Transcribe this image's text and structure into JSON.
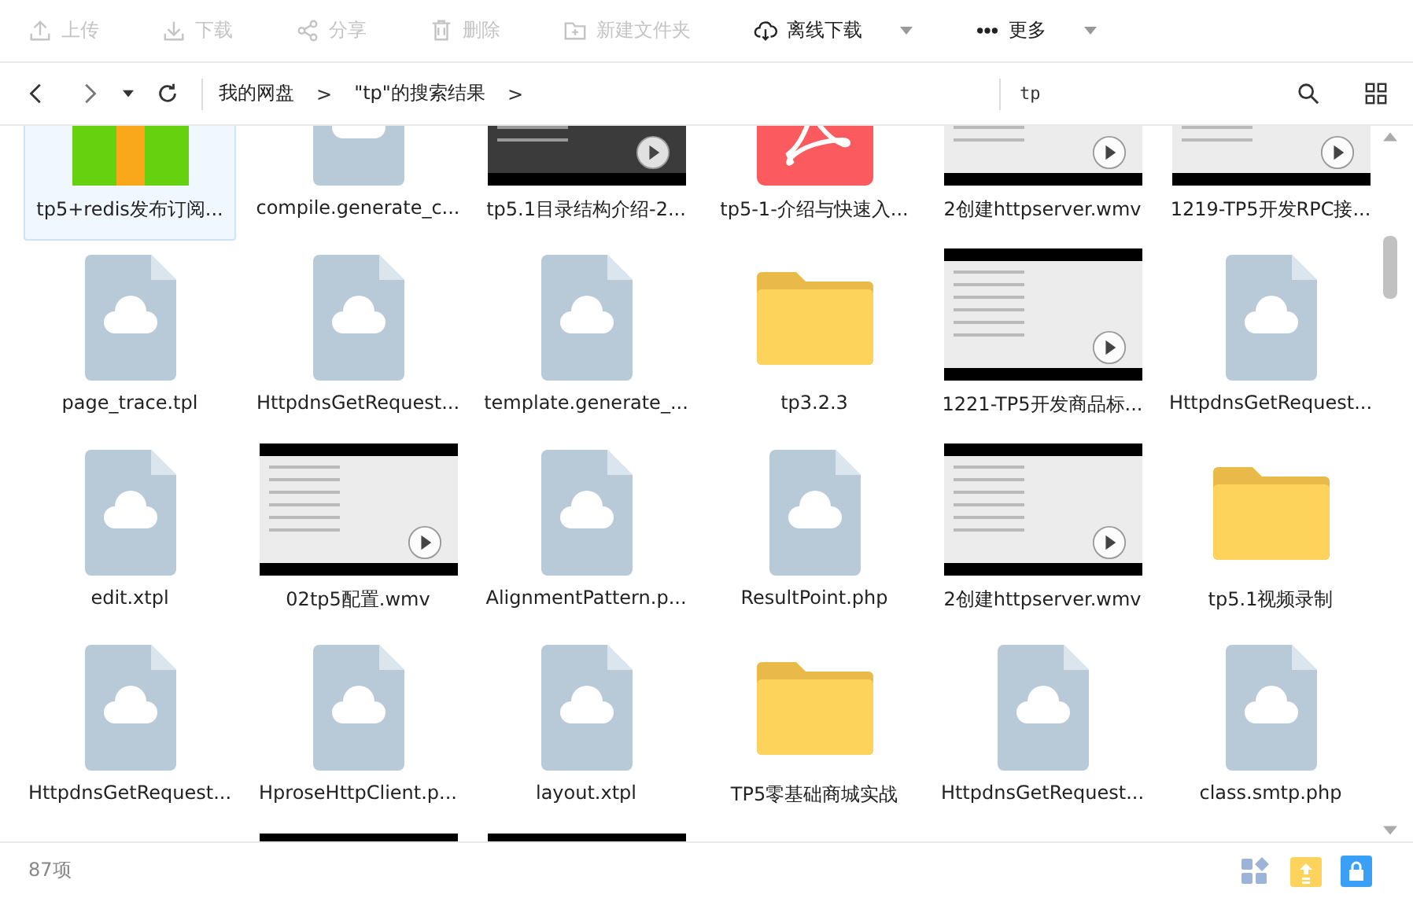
{
  "toolbar": [
    {
      "label": "上传",
      "disabled": true,
      "dropdown": false
    },
    {
      "label": "下载",
      "disabled": true,
      "dropdown": false
    },
    {
      "label": "分享",
      "disabled": true,
      "dropdown": false
    },
    {
      "label": "删除",
      "disabled": true,
      "dropdown": false
    },
    {
      "label": "新建文件夹",
      "disabled": true,
      "dropdown": false
    },
    {
      "label": "离线下载",
      "disabled": false,
      "dropdown": true
    },
    {
      "label": "更多",
      "disabled": false,
      "dropdown": true
    }
  ],
  "breadcrumb": [
    {
      "label": "我的网盘",
      "separator": ">"
    },
    {
      "label": "\"tp\"的搜索结果",
      "separator": ">"
    }
  ],
  "search": {
    "value": "tp"
  },
  "items": [
    {
      "kind": "archive",
      "label": "tp5+redis发布订阅...",
      "selected": true
    },
    {
      "kind": "file",
      "label": "compile.generate_c...",
      "selected": false
    },
    {
      "kind": "video-dark",
      "label": "tp5.1目录结构介绍-2...",
      "selected": false
    },
    {
      "kind": "pdf",
      "label": "tp5-1-介绍与快速入...",
      "selected": false
    },
    {
      "kind": "video",
      "label": "2创建httpserver.wmv",
      "selected": false
    },
    {
      "kind": "video",
      "label": "1219-TP5开发RPC接...",
      "selected": false
    },
    {
      "kind": "file",
      "label": "page_trace.tpl",
      "selected": false
    },
    {
      "kind": "file",
      "label": "HttpdnsGetRequest...",
      "selected": false
    },
    {
      "kind": "file",
      "label": "template.generate_...",
      "selected": false
    },
    {
      "kind": "folder",
      "label": "tp3.2.3",
      "selected": false
    },
    {
      "kind": "video",
      "label": "1221-TP5开发商品标...",
      "selected": false
    },
    {
      "kind": "file",
      "label": "HttpdnsGetRequest...",
      "selected": false
    },
    {
      "kind": "file",
      "label": "edit.xtpl",
      "selected": false
    },
    {
      "kind": "video",
      "label": "02tp5配置.wmv",
      "selected": false
    },
    {
      "kind": "file",
      "label": "AlignmentPattern.p...",
      "selected": false
    },
    {
      "kind": "file",
      "label": "ResultPoint.php",
      "selected": false
    },
    {
      "kind": "video",
      "label": "2创建httpserver.wmv",
      "selected": false
    },
    {
      "kind": "folder",
      "label": "tp5.1视频录制",
      "selected": false
    },
    {
      "kind": "file",
      "label": "HttpdnsGetRequest...",
      "selected": false
    },
    {
      "kind": "file",
      "label": "HproseHttpClient.p...",
      "selected": false
    },
    {
      "kind": "file",
      "label": "layout.xtpl",
      "selected": false
    },
    {
      "kind": "folder",
      "label": "TP5零基础商城实战",
      "selected": false
    },
    {
      "kind": "file",
      "label": "HttpdnsGetRequest...",
      "selected": false
    },
    {
      "kind": "file",
      "label": "class.smtp.php",
      "selected": false
    },
    {
      "kind": "blank",
      "selected": false
    },
    {
      "kind": "video-dark",
      "selected": false
    },
    {
      "kind": "video",
      "selected": false
    }
  ],
  "status": {
    "count": "87项"
  }
}
